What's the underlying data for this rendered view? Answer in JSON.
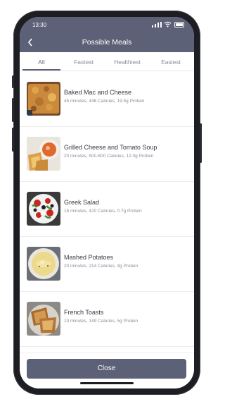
{
  "status_bar": {
    "time": "13:30"
  },
  "nav": {
    "title": "Possible Meals",
    "back_icon": "chevron-left-icon"
  },
  "tabs": [
    {
      "label": "All",
      "active": true
    },
    {
      "label": "Fastest",
      "active": false
    },
    {
      "label": "Healthiest",
      "active": false
    },
    {
      "label": "Easiest",
      "active": false
    }
  ],
  "meals": [
    {
      "name": "Baked Mac and Cheese",
      "meta": "45 minutes, 446 Calories, 19.5g Protein"
    },
    {
      "name": "Grilled Cheese and Tomato Soup",
      "meta": "20 minutes, 500-600 Calories, 12.0g Protein"
    },
    {
      "name": "Greek Salad",
      "meta": "15 minutes, 420 Calories, 0.7g Protein"
    },
    {
      "name": "Mashed Potatoes",
      "meta": "20 minutes, 214 Calories, 4g Protein"
    },
    {
      "name": "French Toasts",
      "meta": "10 minutes, 149 Calories, 5g Protein"
    }
  ],
  "footer": {
    "close_label": "Close"
  },
  "colors": {
    "accent": "#5d6177",
    "muted_text": "#8b8d99",
    "title_text": "#3a3b45"
  }
}
